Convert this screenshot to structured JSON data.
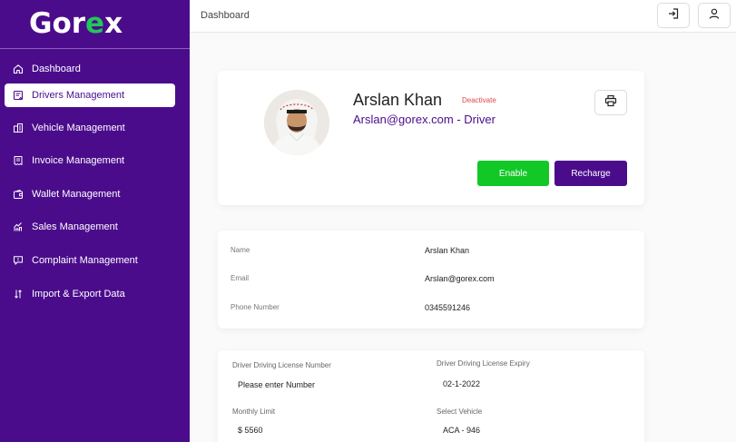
{
  "brand": {
    "logo_main": "Gor",
    "logo_accent": "e",
    "logo_tail": "x",
    "accent_color": "#22c65a",
    "primary_color": "#4b0c8c"
  },
  "sidebar": {
    "items": [
      {
        "label": "Dashboard",
        "icon": "home-icon",
        "active": false
      },
      {
        "label": "Drivers Management",
        "icon": "driver-card-icon",
        "active": true
      },
      {
        "label": "Vehicle Management",
        "icon": "building-icon",
        "active": false
      },
      {
        "label": "Invoice Management",
        "icon": "invoice-icon",
        "active": false
      },
      {
        "label": "Wallet Management",
        "icon": "wallet-icon",
        "active": false
      },
      {
        "label": "Sales  Management",
        "icon": "sales-icon",
        "active": false
      },
      {
        "label": "Complaint  Management",
        "icon": "complaint-icon",
        "active": false
      },
      {
        "label": "Import & Export Data",
        "icon": "import-export-icon",
        "active": false
      }
    ]
  },
  "topbar": {
    "breadcrumb": "Dashboard",
    "logout_icon": "logout-icon",
    "user_icon": "user-icon"
  },
  "profile": {
    "name": "Arslan Khan",
    "status_action": "Deactivate",
    "email_role": "Arslan@gorex.com - Driver",
    "enable_label": "Enable",
    "recharge_label": "Recharge",
    "enable_color": "#11c826"
  },
  "info": {
    "rows": [
      {
        "label": "Name",
        "value": "Arslan Khan"
      },
      {
        "label": "Email",
        "value": "Arslan@gorex.com"
      },
      {
        "label": "Phone Number",
        "value": "0345591246"
      }
    ]
  },
  "form": {
    "license_number_label": "Driver  Driving License  Number",
    "license_number_placeholder": "Please enter Number",
    "license_expiry_label": "Driver  Driving License  Expiry",
    "license_expiry_value": "02-1-2022",
    "monthly_limit_label": "Monthly Limit",
    "monthly_limit_value": "$ 5560",
    "vehicle_label": "Select Vehicle",
    "vehicle_value": "ACA - 946"
  }
}
